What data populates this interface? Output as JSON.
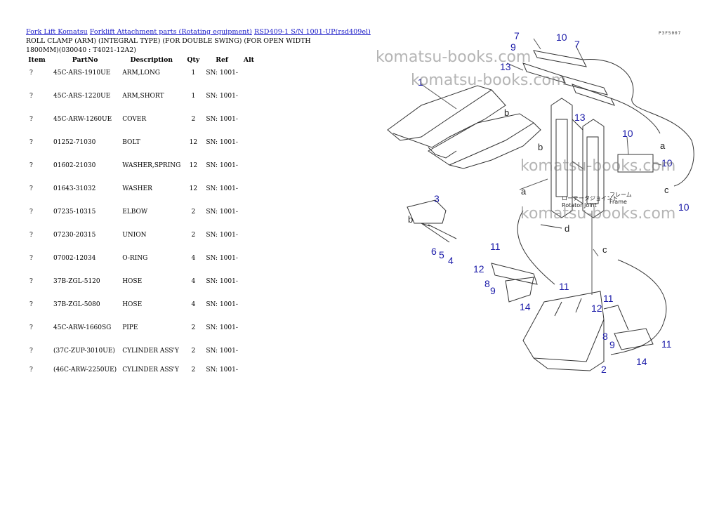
{
  "breadcrumb": {
    "link1": "Fork Lift Komatsu",
    "link2": "Forklift Attachment parts (Rotating equipment)",
    "link3": "RSD409-1 S/N 1001-UP(rsd409el)"
  },
  "page_title": "ROLL CLAMP (ARM) (INTEGRAL TYPE) (FOR DOUBLE SWING) (FOR OPEN WIDTH 1800MM)(030040 : T4021-12A2)",
  "table": {
    "headers": {
      "item": "Item",
      "partno": "PartNo",
      "description": "Description",
      "qty": "Qty",
      "ref": "Ref",
      "alt": "Alt"
    },
    "rows": [
      {
        "item": "?",
        "partno": "45C-ARS-1910UE",
        "description": "ARM,LONG",
        "qty": "1",
        "ref": "SN: 1001-",
        "alt": ""
      },
      {
        "item": "?",
        "partno": "45C-ARS-1220UE",
        "description": "ARM,SHORT",
        "qty": "1",
        "ref": "SN: 1001-",
        "alt": ""
      },
      {
        "item": "?",
        "partno": "45C-ARW-1260UE",
        "description": "COVER",
        "qty": "2",
        "ref": "SN: 1001-",
        "alt": ""
      },
      {
        "item": "?",
        "partno": "01252-71030",
        "description": "BOLT",
        "qty": "12",
        "ref": "SN: 1001-",
        "alt": ""
      },
      {
        "item": "?",
        "partno": "01602-21030",
        "description": "WASHER,SPRING",
        "qty": "12",
        "ref": "SN: 1001-",
        "alt": ""
      },
      {
        "item": "?",
        "partno": "01643-31032",
        "description": "WASHER",
        "qty": "12",
        "ref": "SN: 1001-",
        "alt": ""
      },
      {
        "item": "?",
        "partno": "07235-10315",
        "description": "ELBOW",
        "qty": "2",
        "ref": "SN: 1001-",
        "alt": ""
      },
      {
        "item": "?",
        "partno": "07230-20315",
        "description": "UNION",
        "qty": "2",
        "ref": "SN: 1001-",
        "alt": ""
      },
      {
        "item": "?",
        "partno": "07002-12034",
        "description": "O-RING",
        "qty": "4",
        "ref": "SN: 1001-",
        "alt": ""
      },
      {
        "item": "?",
        "partno": "37B-ZGL-5120",
        "description": "HOSE",
        "qty": "4",
        "ref": "SN: 1001-",
        "alt": ""
      },
      {
        "item": "?",
        "partno": "37B-ZGL-5080",
        "description": "HOSE",
        "qty": "4",
        "ref": "SN: 1001-",
        "alt": ""
      },
      {
        "item": "?",
        "partno": "45C-ARW-1660SG",
        "description": "PIPE",
        "qty": "2",
        "ref": "SN: 1001-",
        "alt": ""
      },
      {
        "item": "?",
        "partno": "(37C-ZUP-3010UE)",
        "description": "CYLINDER ASS'Y",
        "qty": "2",
        "ref": "SN: 1001-",
        "alt": ""
      },
      {
        "item": "?",
        "partno": "(46C-ARW-2250UE)",
        "description": "CYLINDER ASS'Y",
        "qty": "2",
        "ref": "SN: 1001-",
        "alt": ""
      }
    ]
  },
  "watermark": "komatsu-books.com",
  "diagram": {
    "code": "P3F5007",
    "frame_label_jp": "フレーム",
    "frame_label_en": "Frame",
    "joint_label_jp": "ローテータジョイント",
    "joint_label_en": "Rotator Joint",
    "callout_color": "#1a1aa8"
  }
}
